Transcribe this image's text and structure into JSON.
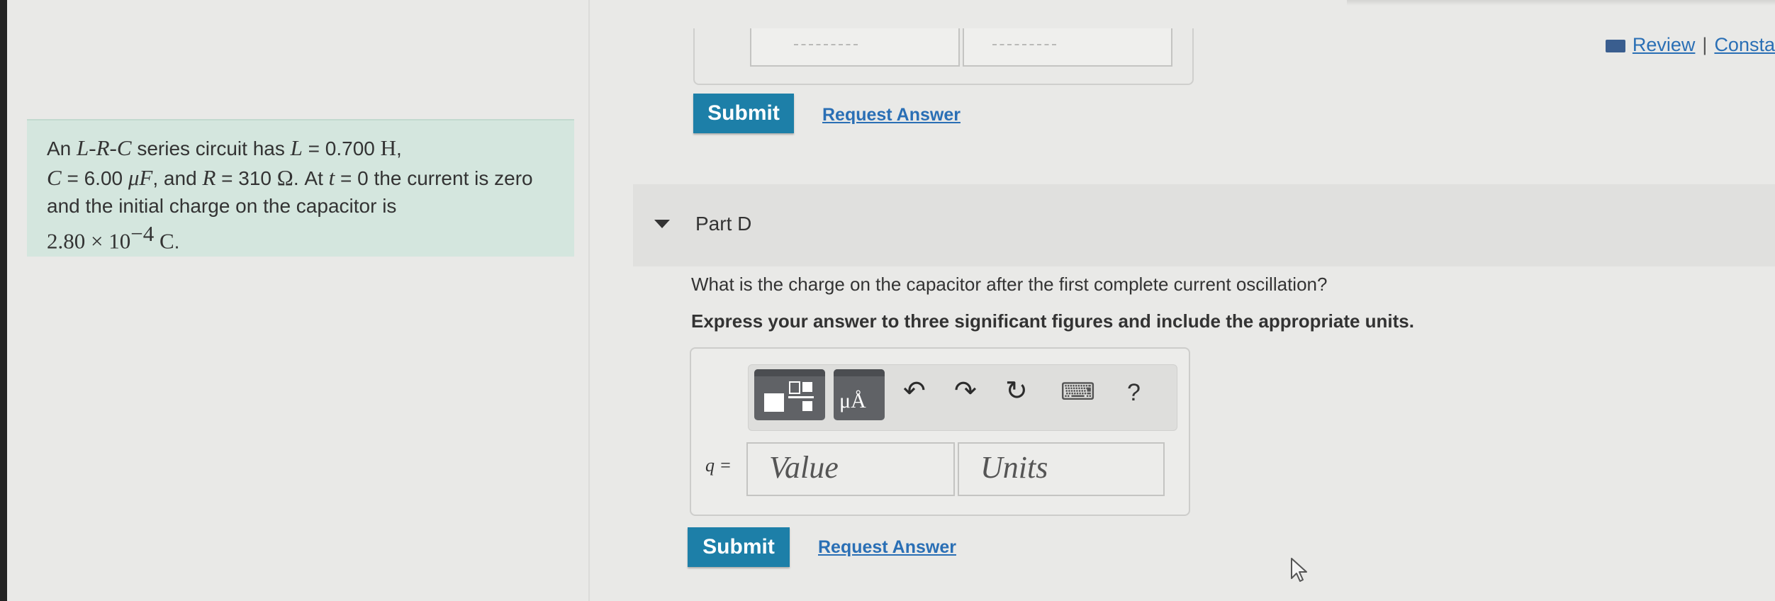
{
  "header": {
    "links": [
      {
        "label": "Review"
      },
      {
        "label": "Consta"
      }
    ],
    "separator": "|"
  },
  "problem": {
    "t1": "An ",
    "L1": "L",
    "dash1": "-",
    "R1": "R",
    "dash2": "-",
    "C1": "C",
    "t2": " series circuit has ",
    "L2": "L",
    "eq1": " = 0.700 ",
    "unitH": "H",
    "comma1": ",",
    "C2": "C",
    "eq2": " = 6.00 ",
    "unitMuF": "μF",
    "t3": ", and ",
    "R2": "R",
    "eq3": " = 310 ",
    "unitOhm": "Ω",
    "t4": ". At ",
    "tvar": "t",
    "t5": " = 0 the current is zero and the initial charge on the capacitor is ",
    "q0mant": "2.80 × 10",
    "q0exp": "−4",
    "q0unit": " C",
    "period": "."
  },
  "prev_part": {
    "submit_label": "Submit",
    "request_label": "Request Answer"
  },
  "part_d": {
    "title": "Part D",
    "question": "What is the charge on the capacitor after the first complete current oscillation?",
    "instruction": "Express your answer to three significant figures and include the appropriate units.",
    "toolbar": {
      "icons": [
        "fraction-template-icon",
        "units-template-icon",
        "undo-icon",
        "redo-icon",
        "reset-icon",
        "keyboard-icon",
        "help-icon"
      ],
      "units_glyph": "μÅ",
      "undo_glyph": "↶",
      "redo_glyph": "↷",
      "reset_glyph": "↻",
      "keyboard_glyph": "⌨",
      "help_glyph": "?"
    },
    "var_label": "q =",
    "value_placeholder": "Value",
    "units_placeholder": "Units",
    "submit_label": "Submit",
    "request_label": "Request Answer"
  },
  "colors": {
    "submit_bg": "#1d7fa8",
    "link": "#2a6fb5",
    "problem_bg": "#d4e6de"
  }
}
